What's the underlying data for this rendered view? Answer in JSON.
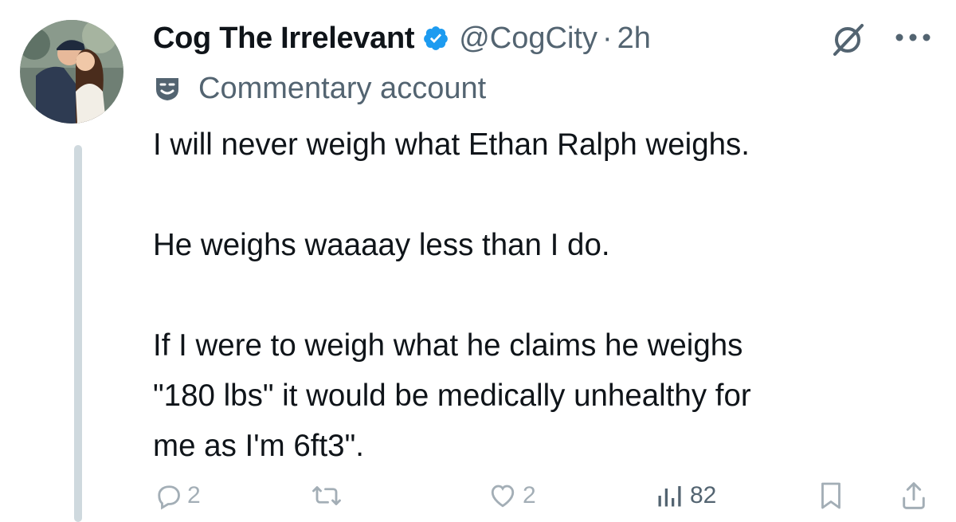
{
  "tweet": {
    "author_name": "Cog The Irrelevant",
    "handle": "@CogCity",
    "separator": "·",
    "time": "2h",
    "label": "Commentary account",
    "paragraphs": [
      [
        "I will never weigh what Ethan Ralph weighs."
      ],
      [
        "He weighs waaaay less than I do."
      ],
      [
        "If I were to weigh what he claims he weighs",
        "\"180 lbs\" it would be medically unhealthy for",
        "me as I'm 6ft3\"."
      ]
    ]
  },
  "actions": {
    "replies": "2",
    "reposts": "",
    "likes": "2",
    "views": "82"
  },
  "colors": {
    "verified": "#1d9bf0",
    "secondary_text": "#536471",
    "thread_line": "#cfd9de"
  },
  "icons": [
    "verified-badge-icon",
    "grok-icon",
    "more-icon",
    "commentary-label-icon",
    "reply-icon",
    "repost-icon",
    "like-icon",
    "views-icon",
    "bookmark-icon",
    "share-icon"
  ]
}
